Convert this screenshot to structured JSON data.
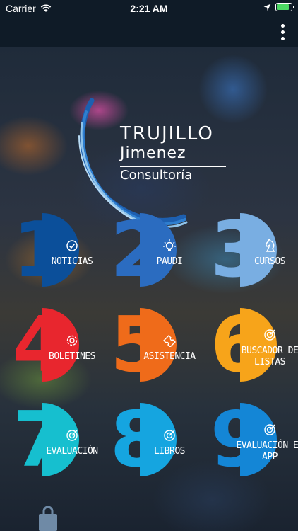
{
  "status": {
    "carrier": "Carrier",
    "time": "2:21 AM",
    "battery_level": 0.85
  },
  "brand": {
    "line1": "TRUJILLO",
    "line2": "Jimenez",
    "line3": "Consultoría"
  },
  "colors": {
    "nav_bg": "#0f1b27",
    "battery_green": "#4cd964",
    "logo_blue": "#2c7ac2",
    "logo_light": "#8fc3ea"
  },
  "tiles": [
    {
      "num": "1",
      "label": "NOTICIAS",
      "icon": "news-clock-icon",
      "color": "#0b4f9a"
    },
    {
      "num": "2",
      "label": "PAUDI",
      "icon": "lightbulb-icon",
      "color": "#2b6cc0"
    },
    {
      "num": "3",
      "label": "CURSOS",
      "icon": "chess-knight-icon",
      "color": "#79aee2"
    },
    {
      "num": "4",
      "label": "BOLETINES",
      "icon": "gear-icon",
      "color": "#e8262e"
    },
    {
      "num": "5",
      "label": "ASISTENCIA",
      "icon": "ticket-icon",
      "color": "#ef6b1a"
    },
    {
      "num": "6",
      "label": "BUSCADOR DE LISTAS",
      "icon": "target-icon",
      "color": "#f7a41a"
    },
    {
      "num": "7",
      "label": "EVALUACIÓN",
      "icon": "target-icon",
      "color": "#16bfcf"
    },
    {
      "num": "8",
      "label": "LIBROS",
      "icon": "target-icon",
      "color": "#15a5e0"
    },
    {
      "num": "9",
      "label": "EVALUACIÓN EN APP",
      "icon": "target-icon",
      "color": "#1486d6"
    }
  ]
}
